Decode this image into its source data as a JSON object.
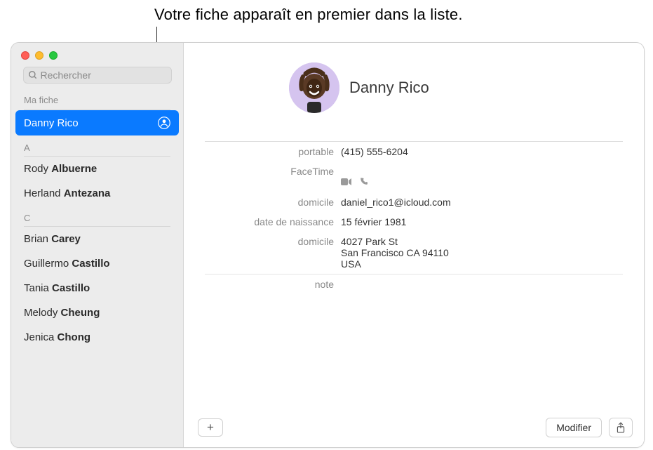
{
  "callout": "Votre fiche apparaît en premier dans la liste.",
  "search": {
    "placeholder": "Rechercher"
  },
  "sidebar": {
    "my_card_label": "Ma fiche",
    "my_card_name": "Danny Rico",
    "sections": [
      {
        "letter": "A",
        "items": [
          {
            "first": "Rody",
            "last": "Albuerne"
          },
          {
            "first": "Herland",
            "last": "Antezana"
          }
        ]
      },
      {
        "letter": "C",
        "items": [
          {
            "first": "Brian",
            "last": "Carey"
          },
          {
            "first": "Guillermo",
            "last": "Castillo"
          },
          {
            "first": "Tania",
            "last": "Castillo"
          },
          {
            "first": "Melody",
            "last": "Cheung"
          },
          {
            "first": "Jenica",
            "last": "Chong"
          }
        ]
      }
    ]
  },
  "card": {
    "name": "Danny Rico",
    "fields": {
      "mobile_label": "portable",
      "mobile_value": "(415) 555-6204",
      "facetime_label": "FaceTime",
      "home_email_label": "domicile",
      "home_email_value": "daniel_rico1@icloud.com",
      "birthday_label": "date de naissance",
      "birthday_value": "15 février 1981",
      "home_addr_label": "domicile",
      "home_addr_value": "4027 Park St\nSan Francisco CA 94110\nUSA",
      "note_label": "note"
    }
  },
  "buttons": {
    "add": "+",
    "edit": "Modifier"
  }
}
